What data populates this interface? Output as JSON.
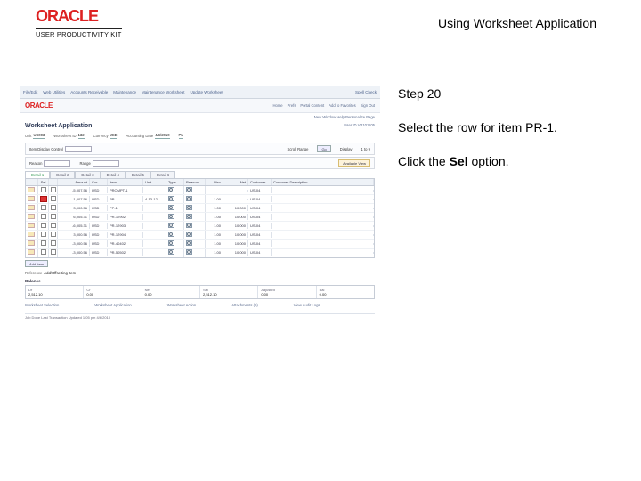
{
  "header": {
    "brand": "ORACLE",
    "brand_sub": "USER PRODUCTIVITY KIT",
    "doc_title": "Using Worksheet Application"
  },
  "instructions": {
    "step_label": "Step 20",
    "line1": "Select the row for item PR-1.",
    "line2_a": "Click the ",
    "line2_b": "Sel",
    "line2_c": " option."
  },
  "app": {
    "menu": [
      "File/Edit",
      "Web Utilities",
      "Accounts Receivable",
      "Maintenance",
      "Maintenance Worksheet",
      "Update Worksheet"
    ],
    "menu_right": "Spell Check",
    "logo": "ORACLE",
    "right_links": [
      "Home",
      "Prefs",
      "Portal Content",
      "Add to Favorites",
      "Sign Out"
    ],
    "subheader_right": "New Window Help Personalize Page",
    "title": "Worksheet Application",
    "title_right": "User ID  VP101105",
    "info": {
      "unit_l": "Unit",
      "unit_v": "US003",
      "ws_l": "Worksheet ID",
      "ws_v": "132",
      "cur_l": "Currency",
      "cur_v": "JCE",
      "acct_l": "Accounting Date",
      "acct_v": "4/6/2010",
      "seq_l": "",
      "seq_v": "PL"
    },
    "filters": {
      "row1_l": "Item Display Control",
      "row1_go": "Go",
      "row2_l": "Item",
      "row2_range_l": "Scroll Range",
      "row2_seq_l": "Display",
      "row2_seq_v": "1 to 9",
      "reason_l": "Reason",
      "range_l": "Range",
      "btn_av": "Available View"
    },
    "tabs": [
      "Detail 1",
      "Detail 2",
      "Detail 3",
      "Detail 4",
      "Detail 5",
      "Detail 6"
    ],
    "columns": [
      "",
      "Sel",
      "",
      "Amount",
      "Cur",
      "Item",
      "Unit",
      "Type",
      "Reason",
      "Disc",
      "Net",
      "Customer",
      "Customer Description"
    ],
    "rows": [
      {
        "sel": false,
        "amt": "-5,007.56",
        "cur": "USD",
        "item": "PROMPT-1",
        "unit": "",
        "reason": "",
        "disc": "",
        "net": "",
        "cust": "US-04"
      },
      {
        "sel": false,
        "amt": "-1,007.56",
        "cur": "USD",
        "item": "PR-",
        "unit": "4-13-12",
        "reason": "",
        "disc": "1.00",
        "net": "",
        "cust": "US-04",
        "highlight": true
      },
      {
        "sel": false,
        "amt": "3,000.56",
        "cur": "USD",
        "item": "PP-1",
        "unit": "",
        "reason": "",
        "disc": "1.00",
        "net": "10,000",
        "cust": "US-04"
      },
      {
        "sel": false,
        "amt": "6,005.31",
        "cur": "USD",
        "item": "PR-12902",
        "unit": "",
        "reason": "",
        "disc": "1.00",
        "net": "10,000",
        "cust": "US-04"
      },
      {
        "sel": false,
        "amt": "-6,005.31",
        "cur": "USD",
        "item": "PR-12903",
        "unit": "",
        "reason": "",
        "disc": "1.00",
        "net": "10,000",
        "cust": "US-04"
      },
      {
        "sel": false,
        "amt": "3,000.56",
        "cur": "USD",
        "item": "PR-12904",
        "unit": "",
        "reason": "",
        "disc": "1.00",
        "net": "10,000",
        "cust": "US-04"
      },
      {
        "sel": false,
        "amt": "-3,000.56",
        "cur": "USD",
        "item": "PR-40402",
        "unit": "",
        "reason": "",
        "disc": "1.00",
        "net": "10,000",
        "cust": "US-04"
      },
      {
        "sel": false,
        "amt": "-3,000.56",
        "cur": "USD",
        "item": "PR-50502",
        "unit": "",
        "reason": "",
        "disc": "1.00",
        "net": "10,000",
        "cust": "US-04"
      }
    ],
    "actions": [
      "Add Item"
    ],
    "ref_label": "Reference",
    "ref_val": "Add/Offsetting Item",
    "summary_label": "Balance",
    "summary": [
      {
        "lbl": "Dr",
        "val": "2,512.10"
      },
      {
        "lbl": "Cr",
        "val": "0.00"
      },
      {
        "lbl": "Net",
        "val": "0.00"
      },
      {
        "lbl": "Sel",
        "val": "2,512.10"
      },
      {
        "lbl": "Adjusted",
        "val": "0.00"
      },
      {
        "lbl": "Bal",
        "val": "0.00"
      }
    ],
    "bottom_links": [
      "Worksheet Selection",
      "Worksheet Application",
      "Worksheet Action",
      "Attachments (0)",
      "View Audit Logs"
    ],
    "status": "Job Done   Last Transaction Updated   1:05 pm   4/6/2010"
  }
}
